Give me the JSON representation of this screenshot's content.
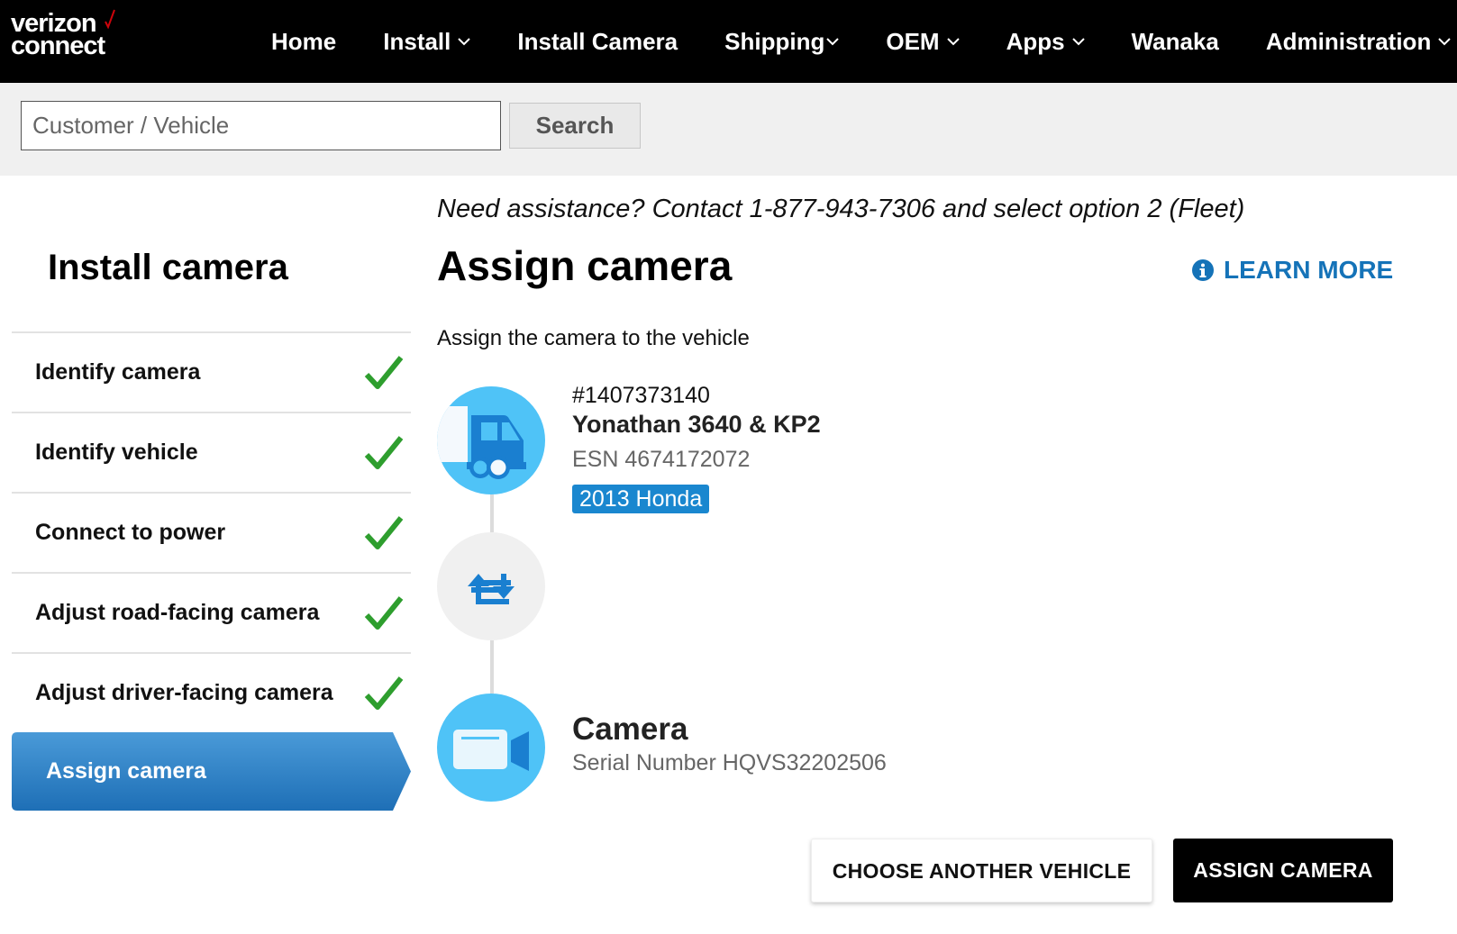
{
  "brand": {
    "line1": "verizon",
    "line2": "connect",
    "accent": "#cd040b"
  },
  "nav": {
    "items": [
      {
        "label": "Home",
        "dropdown": false
      },
      {
        "label": "Install",
        "dropdown": true
      },
      {
        "label": "Install Camera",
        "dropdown": false
      },
      {
        "label": "Shipping",
        "dropdown": true
      },
      {
        "label": "OEM",
        "dropdown": true
      },
      {
        "label": "Apps",
        "dropdown": true
      },
      {
        "label": "Wanaka",
        "dropdown": false
      },
      {
        "label": "Administration",
        "dropdown": true
      }
    ]
  },
  "search": {
    "placeholder": "Customer / Vehicle",
    "button": "Search"
  },
  "sidebar": {
    "title": "Install camera",
    "steps": [
      {
        "label": "Identify camera",
        "done": true
      },
      {
        "label": "Identify vehicle",
        "done": true
      },
      {
        "label": "Connect to power",
        "done": true
      },
      {
        "label": "Adjust road-facing camera",
        "done": true
      },
      {
        "label": "Adjust driver-facing camera",
        "done": true
      }
    ],
    "active_step": "Assign camera"
  },
  "main": {
    "assistance": "Need assistance? Contact 1-877-943-7306 and select option 2 (Fleet)",
    "title": "Assign camera",
    "learn_more": "LEARN MORE",
    "subtitle": "Assign the camera to the vehicle",
    "vehicle": {
      "number": "#1407373140",
      "name": "Yonathan 3640 & KP2",
      "esn": "ESN 4674172072",
      "badge": "2013 Honda"
    },
    "camera": {
      "title": "Camera",
      "serial": "Serial Number HQVS32202506"
    },
    "buttons": {
      "choose_vehicle": "CHOOSE ANOTHER VEHICLE",
      "assign_camera": "ASSIGN CAMERA"
    }
  },
  "colors": {
    "nav_bg": "#000000",
    "accent_blue": "#1573b8",
    "circle_blue": "#4fc3f7",
    "active_step": "#2a7fc4",
    "check_green": "#2e9e2e"
  },
  "icons": [
    "chevron-down-icon",
    "search-icon",
    "check-icon",
    "info-icon",
    "truck-icon",
    "swap-icon",
    "camera-icon"
  ]
}
